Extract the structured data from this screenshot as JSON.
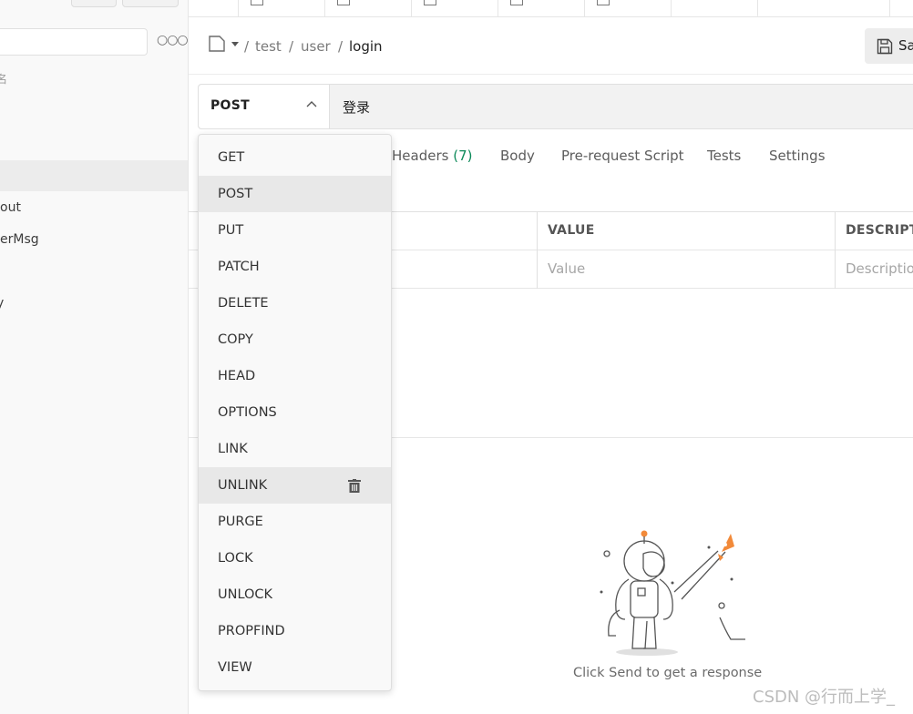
{
  "sidebar": {
    "items": [
      {
        "label": "名"
      },
      {
        "label": ""
      },
      {
        "label": ""
      },
      {
        "label": "out"
      },
      {
        "label": "erMsg"
      },
      {
        "label": "y"
      }
    ]
  },
  "breadcrumb": {
    "segments": [
      "test",
      "user",
      "login"
    ]
  },
  "toolbar": {
    "save_label": "Sa"
  },
  "request": {
    "method": "POST",
    "name": "登录"
  },
  "request_tabs": [
    {
      "label": "Headers",
      "count": "(7)"
    },
    {
      "label": "Body"
    },
    {
      "label": "Pre-request Script"
    },
    {
      "label": "Tests"
    },
    {
      "label": "Settings"
    }
  ],
  "params_table": {
    "headers": [
      "VALUE",
      "DESCRIPT"
    ],
    "placeholders": [
      "Value",
      "Descriptio"
    ]
  },
  "methods": [
    "GET",
    "POST",
    "PUT",
    "PATCH",
    "DELETE",
    "COPY",
    "HEAD",
    "OPTIONS",
    "LINK",
    "UNLINK",
    "PURGE",
    "LOCK",
    "UNLOCK",
    "PROPFIND",
    "VIEW"
  ],
  "response": {
    "empty_text": "Click Send to get a response"
  },
  "watermark": "CSDN @行而上学_",
  "colors": {
    "accent": "#f26b3a",
    "count": "#0d8a5a",
    "highlight": "#e8e8e8"
  }
}
